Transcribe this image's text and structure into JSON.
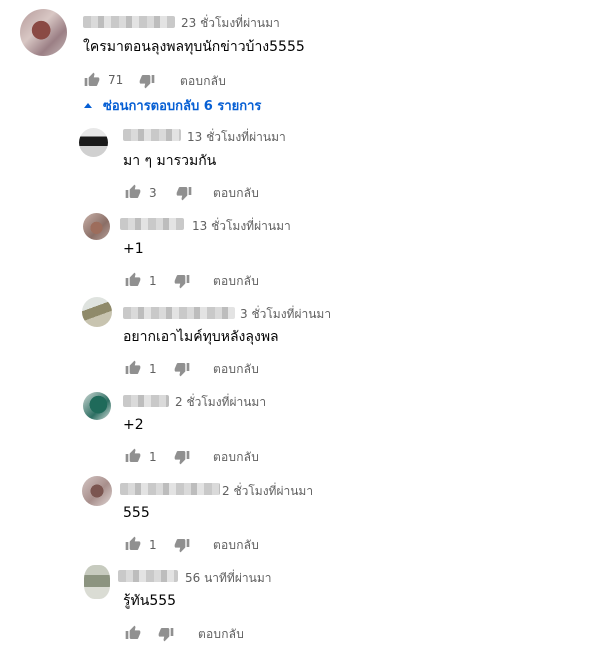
{
  "main_comment": {
    "time": "23 ชั่วโมงที่ผ่านมา",
    "text": "ใครมาตอนลุงพลทุบนักข่าวบ้าง5555",
    "likes": "71",
    "reply_label": "ตอบกลับ"
  },
  "replies_toggle": {
    "label": "ซ่อนการตอบกลับ 6 รายการ",
    "accent_color": "#065fd4"
  },
  "replies": [
    {
      "time": "13 ชั่วโมงที่ผ่านมา",
      "text": "มา ๆ มารวมกัน",
      "likes": "3",
      "reply_label": "ตอบกลับ"
    },
    {
      "time": "13 ชั่วโมงที่ผ่านมา",
      "text": "+1",
      "likes": "1",
      "reply_label": "ตอบกลับ"
    },
    {
      "time": "3 ชั่วโมงที่ผ่านมา",
      "text": "อยากเอาไมค์ทุบหลังลุงพล",
      "likes": "1",
      "reply_label": "ตอบกลับ"
    },
    {
      "time": "2 ชั่วโมงที่ผ่านมา",
      "text": "+2",
      "likes": "1",
      "reply_label": "ตอบกลับ"
    },
    {
      "time": "2 ชั่วโมงที่ผ่านมา",
      "text": "555",
      "likes": "1",
      "reply_label": "ตอบกลับ"
    },
    {
      "time": "56 นาทีที่ผ่านมา",
      "text": "รู้ทัน555",
      "likes": "",
      "reply_label": "ตอบกลับ"
    }
  ]
}
